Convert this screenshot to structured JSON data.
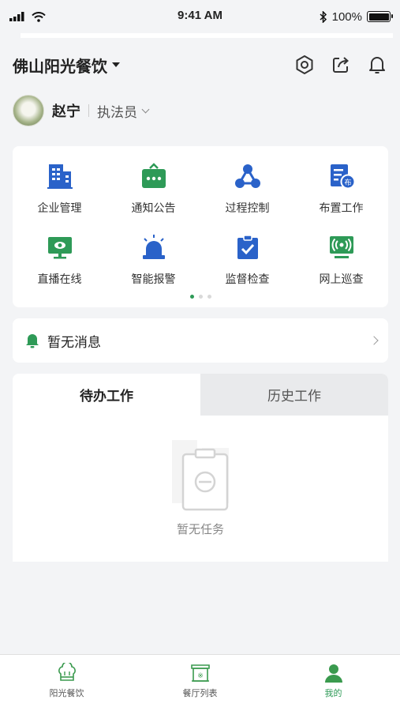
{
  "status_bar": {
    "time": "9:41 AM",
    "battery_text": "100%"
  },
  "header": {
    "org_name": "佛山阳光餐饮",
    "icons": [
      "settings-icon",
      "share-icon",
      "bell-icon"
    ]
  },
  "user": {
    "name": "赵宁",
    "role": "执法员"
  },
  "menu": {
    "items": [
      {
        "label": "企业管理",
        "icon": "building-icon",
        "color": "#2a62c9"
      },
      {
        "label": "通知公告",
        "icon": "notice-icon",
        "color": "#2e9a57"
      },
      {
        "label": "过程控制",
        "icon": "network-icon",
        "color": "#2a62c9"
      },
      {
        "label": "布置工作",
        "icon": "assign-icon",
        "color": "#2a62c9"
      },
      {
        "label": "直播在线",
        "icon": "monitor-icon",
        "color": "#2e9a57"
      },
      {
        "label": "智能报警",
        "icon": "alarm-icon",
        "color": "#2a62c9"
      },
      {
        "label": "监督检查",
        "icon": "clipboard-check-icon",
        "color": "#2a62c9"
      },
      {
        "label": "网上巡查",
        "icon": "broadcast-icon",
        "color": "#2e9a57"
      }
    ],
    "page_count": 3,
    "active_page": 1
  },
  "notice": {
    "text": "暂无消息"
  },
  "tasks": {
    "tabs": [
      {
        "label": "待办工作",
        "active": true
      },
      {
        "label": "历史工作",
        "active": false
      }
    ],
    "empty_text": "暂无任务"
  },
  "bottom_nav": {
    "items": [
      {
        "label": "阳光餐饮",
        "icon": "chef-hat-icon",
        "active": false
      },
      {
        "label": "餐厅列表",
        "icon": "store-icon",
        "active": false
      },
      {
        "label": "我的",
        "icon": "user-icon",
        "active": true
      }
    ]
  },
  "colors": {
    "accent_green": "#2e9a57",
    "accent_blue": "#2a62c9",
    "background": "#f3f4f6"
  }
}
